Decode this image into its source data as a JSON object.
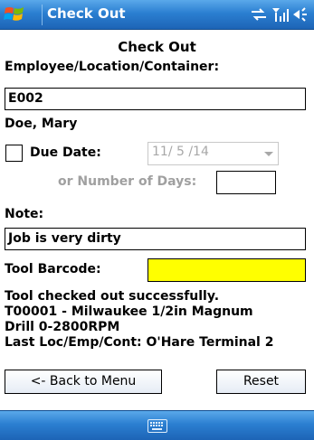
{
  "titlebar": {
    "title": "Check Out",
    "icons": [
      "windows-start-icon",
      "sync-icon",
      "signal-icon",
      "volume-icon"
    ]
  },
  "form": {
    "heading": "Check Out",
    "employee_label": "Employee/Location/Container:",
    "employee_value": "E002",
    "employee_name": "Doe, Mary",
    "due_date_label": "Due Date:",
    "due_date_checked": false,
    "due_date_value": "11/ 5 /14",
    "days_label": "or Number of Days:",
    "days_value": "",
    "note_label": "Note:",
    "note_value": "Job is very dirty",
    "barcode_label": "Tool Barcode:",
    "barcode_value": ""
  },
  "status": {
    "lines": [
      "Tool checked out successfully.",
      "T00001 - Milwaukee 1/2in Magnum",
      "Drill 0-2800RPM",
      "Last Loc/Emp/Cont:  O'Hare Terminal 2"
    ]
  },
  "buttons": {
    "back_label": "<- Back to Menu",
    "reset_label": "Reset"
  },
  "colors": {
    "bar_blue": "#2b7fd1",
    "barcode_highlight": "#ffff00",
    "disabled_text": "#a0a0a0"
  },
  "bottombar": {
    "icon": "keyboard-icon"
  }
}
